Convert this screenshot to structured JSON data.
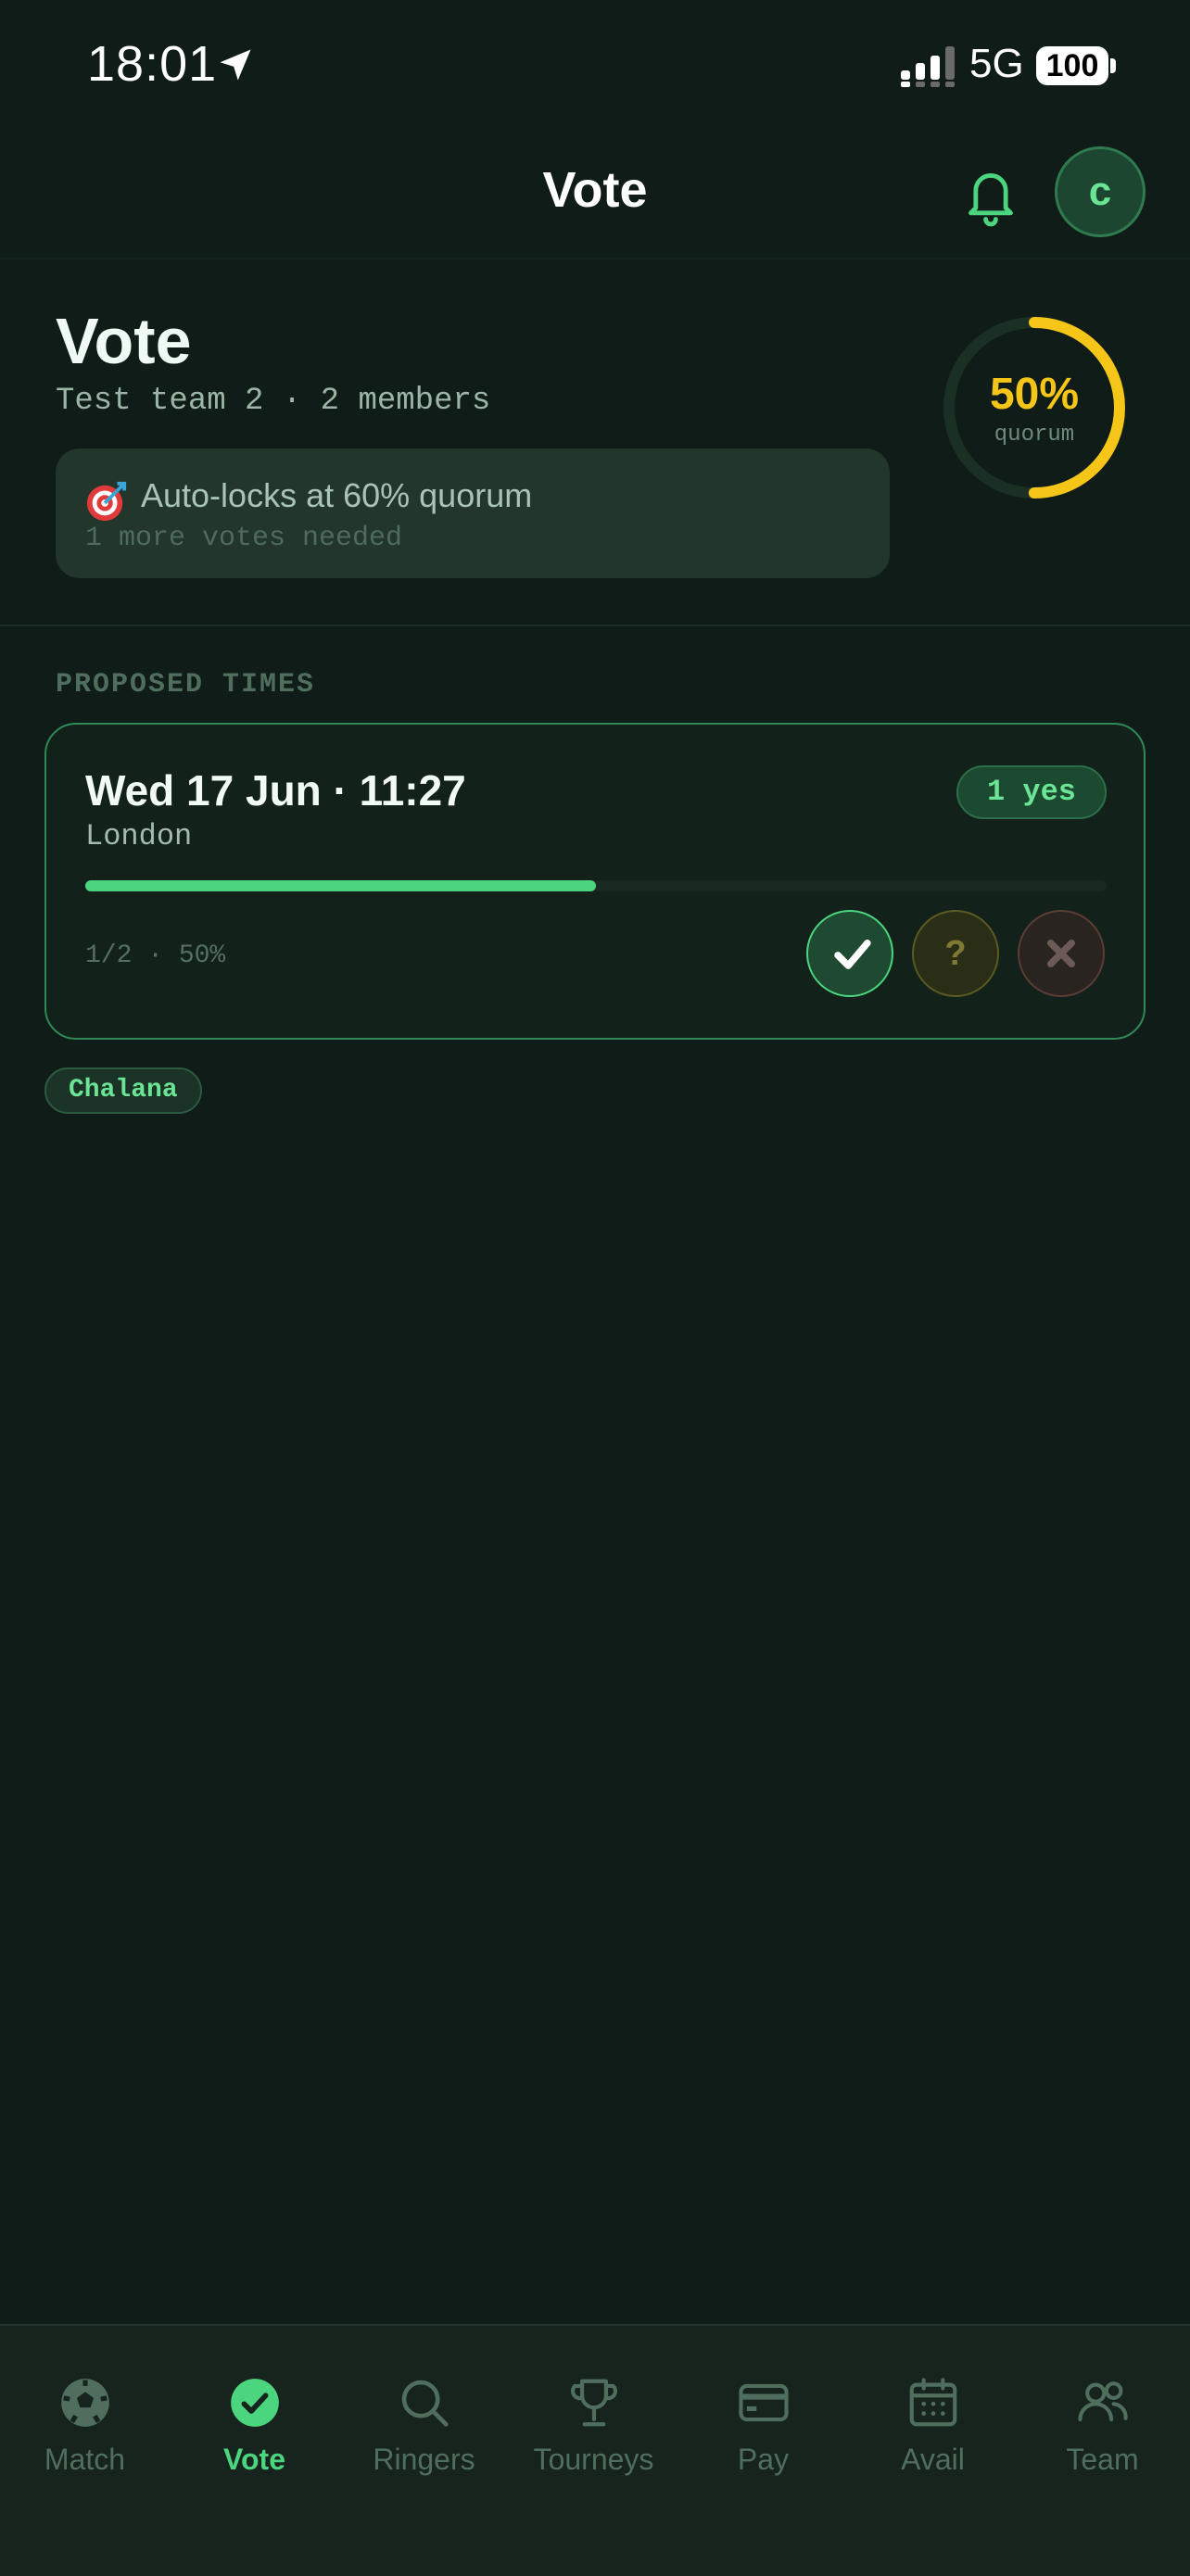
{
  "status_bar": {
    "time": "18:01",
    "network": "5G",
    "battery": "100"
  },
  "header": {
    "title": "Vote",
    "avatar_initial": "c"
  },
  "summary": {
    "title": "Vote",
    "subtitle": "Test team 2 · 2 members",
    "lock_notice": "Auto-locks at 60% quorum",
    "lock_sub": "1 more votes needed",
    "quorum_pct_text": "50%",
    "quorum_label": "quorum",
    "quorum_fraction": 0.5
  },
  "section_label": "PROPOSED TIMES",
  "proposed_times": [
    {
      "title": "Wed 17 Jun · 11:27",
      "location": "London",
      "badge": "1 yes",
      "count_text": "1/2 · 50%",
      "progress_fraction": 0.5,
      "maybe_symbol": "?"
    }
  ],
  "voters": [
    "Chalana"
  ],
  "tabs": [
    {
      "label": "Match",
      "icon": "soccer-ball-icon",
      "active": false
    },
    {
      "label": "Vote",
      "icon": "check-circle-icon",
      "active": true
    },
    {
      "label": "Ringers",
      "icon": "search-icon",
      "active": false
    },
    {
      "label": "Tourneys",
      "icon": "trophy-icon",
      "active": false
    },
    {
      "label": "Pay",
      "icon": "card-icon",
      "active": false
    },
    {
      "label": "Avail",
      "icon": "calendar-icon",
      "active": false
    },
    {
      "label": "Team",
      "icon": "people-icon",
      "active": false
    }
  ],
  "colors": {
    "accent": "#4cd57f",
    "quorum": "#f5c518",
    "background": "#101c17"
  }
}
